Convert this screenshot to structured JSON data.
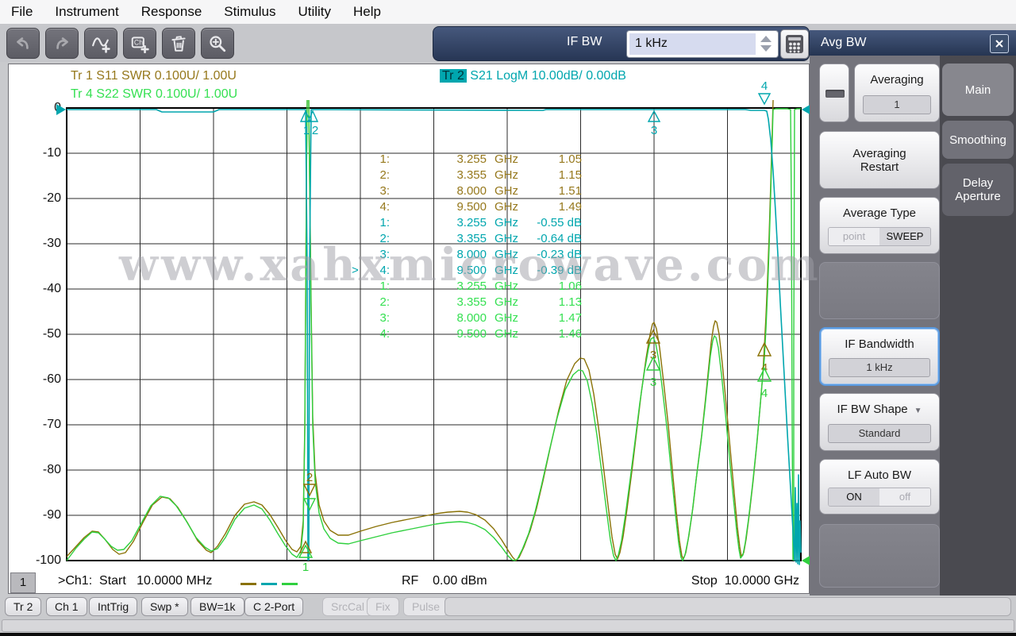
{
  "menu": {
    "items": [
      "File",
      "Instrument",
      "Response",
      "Stimulus",
      "Utility",
      "Help"
    ]
  },
  "toolbar": {
    "if_bw_label": "IF BW",
    "if_bw_value": "1 kHz"
  },
  "trace_header": {
    "tr1": {
      "id": "Tr 1",
      "meas": " S11 SWR 0.100U/ 1.00U"
    },
    "tr2": {
      "id": "Tr 2",
      "meas": " S21 LogM 10.00dB/ 0.00dB"
    },
    "tr4": {
      "id": "Tr 4",
      "meas": " S22 SWR 0.100U/ 1.00U"
    }
  },
  "y_axis": {
    "labels": [
      "0",
      "-10",
      "-20",
      "-30",
      "-40",
      "-50",
      "-60",
      "-70",
      "-80",
      "-90",
      "-100"
    ]
  },
  "marker_table": {
    "rows": [
      {
        "pre": "",
        "n": "1:",
        "freq": "3.255",
        "unit": "GHz",
        "val": "1.05"
      },
      {
        "pre": "",
        "n": "2:",
        "freq": "3.355",
        "unit": "GHz",
        "val": "1.15"
      },
      {
        "pre": "",
        "n": "3:",
        "freq": "8.000",
        "unit": "GHz",
        "val": "1.51"
      },
      {
        "pre": "",
        "n": "4:",
        "freq": "9.500",
        "unit": "GHz",
        "val": "1.49"
      },
      {
        "pre": "",
        "n": "1:",
        "freq": "3.255",
        "unit": "GHz",
        "val": "-0.55 dB"
      },
      {
        "pre": "",
        "n": "2:",
        "freq": "3.355",
        "unit": "GHz",
        "val": "-0.64 dB"
      },
      {
        "pre": "",
        "n": "3:",
        "freq": "8.000",
        "unit": "GHz",
        "val": "-0.23 dB"
      },
      {
        "pre": ">",
        "n": "4:",
        "freq": "9.500",
        "unit": "GHz",
        "val": "-0.39 dB"
      },
      {
        "pre": "",
        "n": "1:",
        "freq": "3.255",
        "unit": "GHz",
        "val": "1.06"
      },
      {
        "pre": "",
        "n": "2:",
        "freq": "3.355",
        "unit": "GHz",
        "val": "1.13"
      },
      {
        "pre": "",
        "n": "3:",
        "freq": "8.000",
        "unit": "GHz",
        "val": "1.47"
      },
      {
        "pre": "",
        "n": "4:",
        "freq": "9.500",
        "unit": "GHz",
        "val": "1.46"
      }
    ]
  },
  "plot_markers": {
    "m1": "1",
    "m2": "2",
    "m3": "3",
    "m4": "4"
  },
  "channel_status": {
    "tab": "1",
    "start": ">Ch1:  Start   10.0000 MHz",
    "rf": "RF    0.00 dBm",
    "stop": "Stop  10.0000 GHz"
  },
  "side_panel": {
    "title": "Avg BW",
    "tabs": [
      "Main",
      "Smoothing",
      "Delay Aperture"
    ],
    "averaging": {
      "label": "Averaging",
      "value": "1"
    },
    "averaging_restart": "Averaging Restart",
    "average_type": {
      "label": "Average Type",
      "opt_off": "point",
      "opt_on": "SWEEP",
      "selected": "SWEEP"
    },
    "if_bandwidth": {
      "label": "IF Bandwidth",
      "value": "1 kHz"
    },
    "if_bw_shape": {
      "label": "IF BW Shape",
      "value": "Standard",
      "dropdown": "▼"
    },
    "lf_auto_bw": {
      "label": "LF Auto BW",
      "opt_on": "ON",
      "opt_off": "off",
      "selected": "ON"
    }
  },
  "status_bar": {
    "buttons": [
      {
        "label": "Tr 2",
        "enabled": true
      },
      {
        "label": "Ch 1",
        "enabled": true
      },
      {
        "label": "IntTrig",
        "enabled": true
      },
      {
        "label": "Swp *",
        "enabled": true
      },
      {
        "label": "BW=1k",
        "enabled": true
      },
      {
        "label": "C 2-Port",
        "enabled": true
      },
      {
        "label": "SrcCal",
        "enabled": false
      },
      {
        "label": "Fix",
        "enabled": false
      },
      {
        "label": "Pulse",
        "enabled": false
      }
    ]
  },
  "watermark": "www.xahxmicrowave.com",
  "colors": {
    "tr1": "#96781c",
    "tr2": "#00a6ae",
    "tr4": "#35e052",
    "navy": "#2d3c5c",
    "selection_blue": "#5a9ae0"
  },
  "chart_data": {
    "type": "line",
    "title": "VNA 2-port filter measurement",
    "x_axis": {
      "start_label": "Start 10.0000 MHz",
      "stop_label": "Stop 10.0000 GHz",
      "start_ghz": 0.01,
      "stop_ghz": 10.0,
      "divisions": 10
    },
    "y_axis_logmag": {
      "trace": "Tr 2 S21 LogM",
      "scale_db_per_div": 10.0,
      "ref_db": 0.0,
      "min": -100,
      "max": 0
    },
    "y_axis_swr": {
      "traces": "Tr 1 / Tr 4 SWR",
      "scale_per_div": 0.1,
      "ref": 1.0,
      "min": 1.0,
      "max": 2.0
    },
    "grid": {
      "x_divisions": 10,
      "y_divisions": 10
    },
    "rf_power": "RF 0.00 dBm",
    "series": [
      {
        "name": "Tr 1 S11 SWR",
        "color": "#96781c",
        "marker_points_ghz_val": [
          [
            3.255,
            1.05
          ],
          [
            3.355,
            1.15
          ],
          [
            8.0,
            1.51
          ],
          [
            9.5,
            1.49
          ]
        ],
        "shape": "SWR ripple 1.0-1.15 below 3.2 GHz, spike above 2.0 at 3.3 GHz notch, deep oscillations peaking ~1.5 between 7 and 9.6 GHz, off-scale high above 9.7 GHz"
      },
      {
        "name": "Tr 2 S21 LogM",
        "color": "#00a6ae",
        "marker_points_ghz_db": [
          [
            3.255,
            -0.55
          ],
          [
            3.355,
            -0.64
          ],
          [
            8.0,
            -0.23
          ],
          [
            9.5,
            -0.39
          ]
        ],
        "shape": "~0 dB flat passband with one narrow notch to below -100 dB at ~3.3 GHz and steep roll-off below -100 dB above 9.6 GHz"
      },
      {
        "name": "Tr 4 S22 SWR",
        "color": "#35e052",
        "marker_points_ghz_val": [
          [
            3.255,
            1.06
          ],
          [
            3.355,
            1.13
          ],
          [
            8.0,
            1.47
          ],
          [
            9.5,
            1.46
          ]
        ],
        "shape": "similar ripple/oscillation pattern to Tr 1"
      }
    ],
    "active_marker": 4
  }
}
